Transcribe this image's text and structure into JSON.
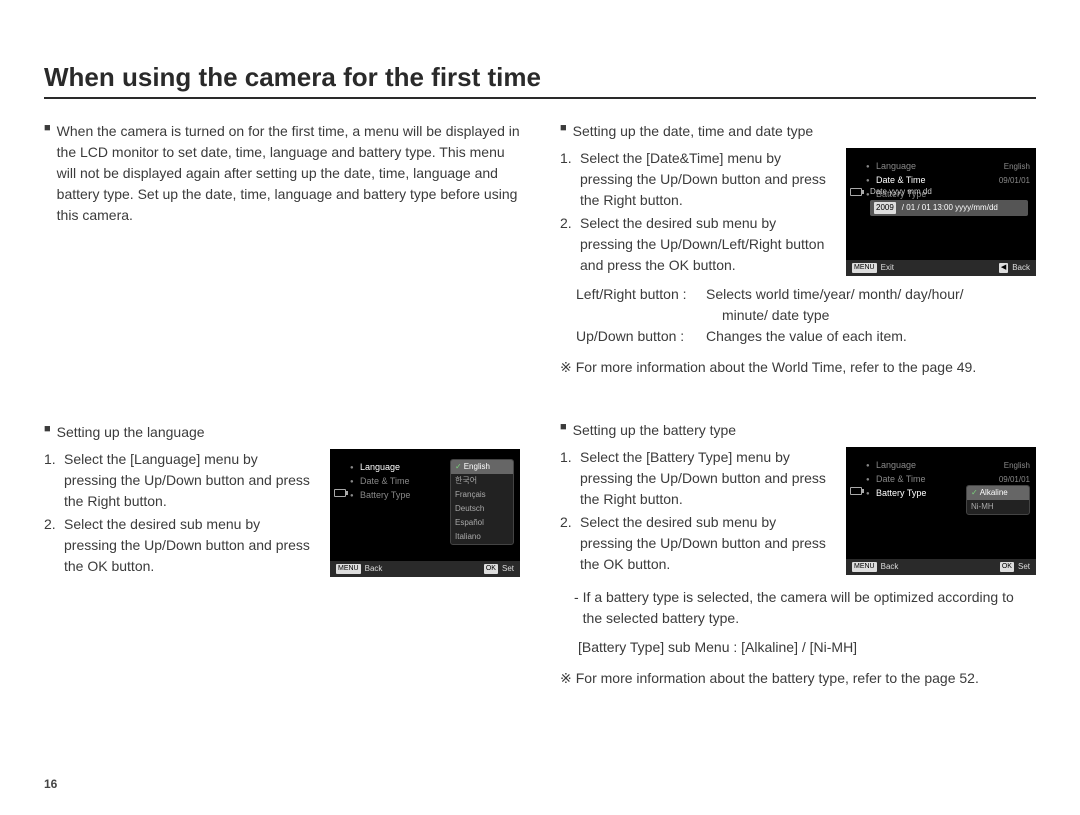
{
  "page": {
    "title": "When using the camera for the first time",
    "number": "16"
  },
  "left": {
    "intro": "When the camera is turned on for the first time, a menu will be displayed in the LCD monitor to set date, time, language and battery type. This menu will not be displayed again after setting up the date, time, language and battery type. Set up the date, time, language and battery type before using this camera.",
    "lang_heading": "Setting up the language",
    "lang_step1": "Select the [Language] menu by pressing the Up/Down button and press the Right button.",
    "lang_step2": "Select the desired sub menu by pressing the Up/Down button and press the OK button."
  },
  "right": {
    "date_heading": "Setting up the date, time and date type",
    "date_step1": "Select the [Date&Time] menu by pressing the Up/Down button and press the Right button.",
    "date_step2": "Select the desired sub menu by pressing the Up/Down/Left/Right button and press the OK button.",
    "lr_label": "Left/Right button :",
    "lr_text": "Selects world time/year/ month/ day/hour/",
    "lr_text2": "minute/ date type",
    "ud_label": "Up/Down button :",
    "ud_text": "Changes the value of each item.",
    "date_note": "For more information about the World Time, refer to the page 49.",
    "batt_heading": "Setting up the battery type",
    "batt_step1": "Select the [Battery Type] menu by pressing the Up/Down button and press the Right button.",
    "batt_step2": "Select the desired sub menu by pressing the Up/Down button and press the OK button.",
    "batt_opt_note": "If a battery type is selected, the camera will be optimized according to the selected battery type.",
    "batt_sub": "[Battery Type] sub Menu : [Alkaline] / [Ni-MH]",
    "batt_note": "For more information about the battery type, refer to the page 52."
  },
  "lcd_lang": {
    "items": [
      "Language",
      "Date & Time",
      "Battery Type"
    ],
    "options": [
      "English",
      "한국어",
      "Français",
      "Deutsch",
      "Español",
      "Italiano"
    ],
    "footer_left_key": "MENU",
    "footer_left": "Back",
    "footer_right_key": "OK",
    "footer_right": "Set"
  },
  "lcd_date": {
    "items": [
      "Language",
      "Date & Time",
      "Battery Type"
    ],
    "values": [
      "English",
      "09/01/01",
      ""
    ],
    "toplabel": "Date  yyyy mm dd",
    "edit": {
      "year": "2009",
      "rest": "/ 01 / 01   13:00   yyyy/mm/dd"
    },
    "footer_left_key": "MENU",
    "footer_left": "Exit",
    "footer_right_key": "◀",
    "footer_right": "Back"
  },
  "lcd_batt": {
    "items": [
      "Language",
      "Date & Time",
      "Battery Type"
    ],
    "values": [
      "English",
      "09/01/01",
      ""
    ],
    "options": [
      "Alkaline",
      "Ni-MH"
    ],
    "footer_left_key": "MENU",
    "footer_left": "Back",
    "footer_right_key": "OK",
    "footer_right": "Set"
  },
  "glyph": {
    "square": "■",
    "ref": "※",
    "dash": "-"
  }
}
